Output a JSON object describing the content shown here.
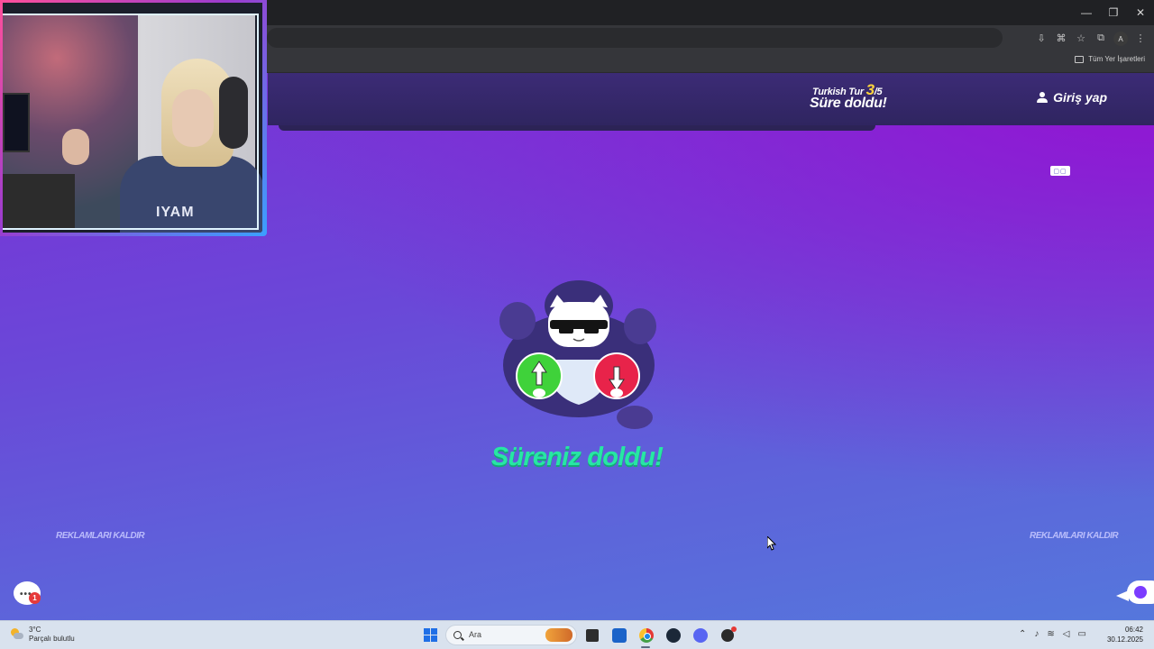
{
  "browser": {
    "window_controls": {
      "minimize": "—",
      "restore": "❐",
      "close": "✕"
    },
    "toolbar_icons": [
      "download-icon",
      "translate-icon",
      "star-icon",
      "extensions-icon",
      "profile-avatar",
      "menu-icon"
    ],
    "profile_initial": "A",
    "bookmarks_all_label": "Tüm Yer İşaretleri"
  },
  "game": {
    "round_prefix": "Turkish Tur",
    "round_current": "3",
    "round_total": "/5",
    "header_status": "Süre doldu!",
    "login_label": "Giriş yap",
    "main_message": "Süreniz doldu!",
    "remove_ads_left": "REKLAMLARI KALDIR",
    "remove_ads_right": "REKLAMLARI KALDIR",
    "chat_badge_count": "1",
    "colors": {
      "accent_green": "#27e6a4",
      "round_number": "#ffd43c",
      "up_button": "#3fd23a",
      "down_button": "#e8234a"
    }
  },
  "webcam": {
    "shirt_text": "IYAM"
  },
  "taskbar": {
    "weather_temp": "3°C",
    "weather_desc": "Parçalı bulutlu",
    "search_placeholder": "Ara",
    "apps": [
      "start-icon",
      "files-icon",
      "store-icon",
      "chrome-icon",
      "steam-icon",
      "discord-icon",
      "obs-icon"
    ],
    "clock_time": "06:42",
    "clock_date": "30.12.2025"
  }
}
